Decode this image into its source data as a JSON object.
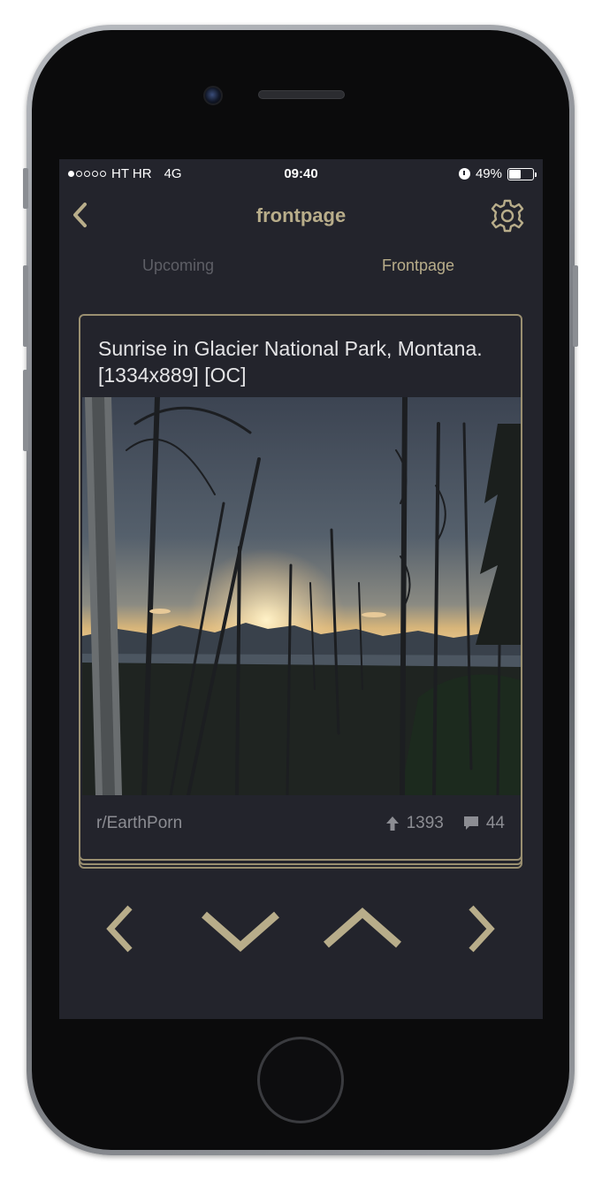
{
  "status_bar": {
    "carrier": "HT HR",
    "network": "4G",
    "time": "09:40",
    "battery": "49%",
    "signal_bars_filled": 1,
    "signal_bars_total": 5,
    "battery_level": 0.49
  },
  "nav": {
    "title": "frontpage",
    "back_icon": "chevron-left-icon",
    "settings_icon": "gear-icon"
  },
  "tabs": [
    {
      "label": "Upcoming",
      "active": false
    },
    {
      "label": "Frontpage",
      "active": true
    }
  ],
  "post": {
    "title": "Sunrise in Glacier National Park, Montana. [1334x889] [OC]",
    "subreddit": "r/EarthPorn",
    "upvotes": "1393",
    "comments": "44",
    "upvote_icon": "arrow-up-icon",
    "comment_icon": "comment-bubble-icon",
    "image_description_icon": "landscape-photo"
  },
  "controls": [
    {
      "name": "previous",
      "icon": "chevron-left-icon"
    },
    {
      "name": "downvote",
      "icon": "chevron-down-icon"
    },
    {
      "name": "upvote",
      "icon": "chevron-up-icon"
    },
    {
      "name": "next",
      "icon": "chevron-right-icon"
    }
  ],
  "colors": {
    "screen_bg": "#23242c",
    "accent": "#b8ad8a",
    "card_border": "#9a8f70",
    "muted_text": "#8c8d93",
    "inactive_tab": "#5e5f66"
  }
}
